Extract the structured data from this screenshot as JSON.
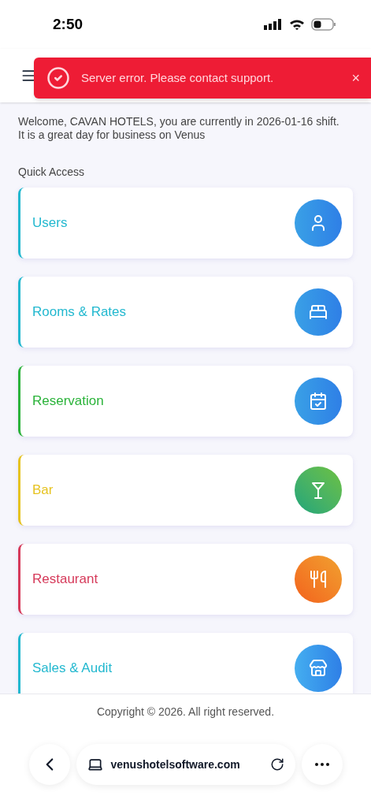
{
  "status_bar": {
    "time": "2:50"
  },
  "toast": {
    "message": "Server error. Please contact support.",
    "close": "×"
  },
  "welcome": "Welcome, CAVAN HOTELS, you are currently in 2026-01-16 shift. It is a great day for business on Venus",
  "quick_access": {
    "title": "Quick Access",
    "items": [
      {
        "label": "Users",
        "color": "#22b8cf"
      },
      {
        "label": "Rooms & Rates",
        "color": "#22b8cf"
      },
      {
        "label": "Reservation",
        "color": "#2bb33a"
      },
      {
        "label": "Bar",
        "color": "#e6c321"
      },
      {
        "label": "Restaurant",
        "color": "#d63a5a"
      },
      {
        "label": "Sales & Audit",
        "color": "#22b8cf"
      }
    ]
  },
  "footer": {
    "copyright": "Copyright © 2026. All right reserved."
  },
  "browser": {
    "url": "venushotelsoftware.com"
  }
}
